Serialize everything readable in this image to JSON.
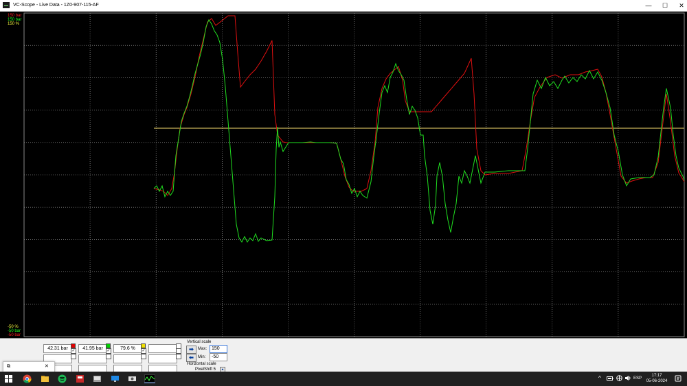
{
  "window": {
    "title": "VC-Scope - Live Data - 1Z0-907-115-AF",
    "minimize_glyph": "—",
    "maximize_glyph": "☐",
    "close_glyph": "✕"
  },
  "scope": {
    "top_labels": [
      {
        "text": "150 bar",
        "color": "#ff2020"
      },
      {
        "text": "150 bar",
        "color": "#20ff20"
      },
      {
        "text": "150 %",
        "color": "#ffff40"
      }
    ],
    "bottom_labels": [
      {
        "text": "-50 %",
        "color": "#ffff40"
      },
      {
        "text": "-50 bar",
        "color": "#20ff20"
      },
      {
        "text": "-50 bar",
        "color": "#ff2020"
      }
    ],
    "grid_color": "#b0b0b0",
    "trace_colors": {
      "red": "#e01010",
      "green": "#20e020",
      "yellow": "#c8b45a"
    }
  },
  "channels": [
    {
      "value": "42.31 bar",
      "color": "#e00000",
      "checked": true
    },
    {
      "value": "41.95 bar",
      "color": "#00d000",
      "checked": true
    },
    {
      "value": "79.6 %",
      "color": "#f0e000",
      "checked": true
    },
    {
      "value": "",
      "color": "",
      "checked": false
    }
  ],
  "vertical_scale": {
    "title": "Vertical scale",
    "max_label": "Max:",
    "max_value": "150",
    "min_label": "Min:",
    "min_value": "-50"
  },
  "horizontal_scale": {
    "title": "Horizontal scale",
    "value": "PixelShift 5"
  },
  "taskbar": {
    "icons": [
      "windows-start-icon",
      "chrome-icon",
      "file-explorer-icon",
      "spotify-icon",
      "app-red-icon",
      "app-gray-icon",
      "remote-desktop-icon",
      "app-settings-icon",
      "vc-scope-icon"
    ],
    "language": "ESP",
    "time": "17:17",
    "date": "05-06-2024",
    "tray_up_glyph": "^"
  }
}
